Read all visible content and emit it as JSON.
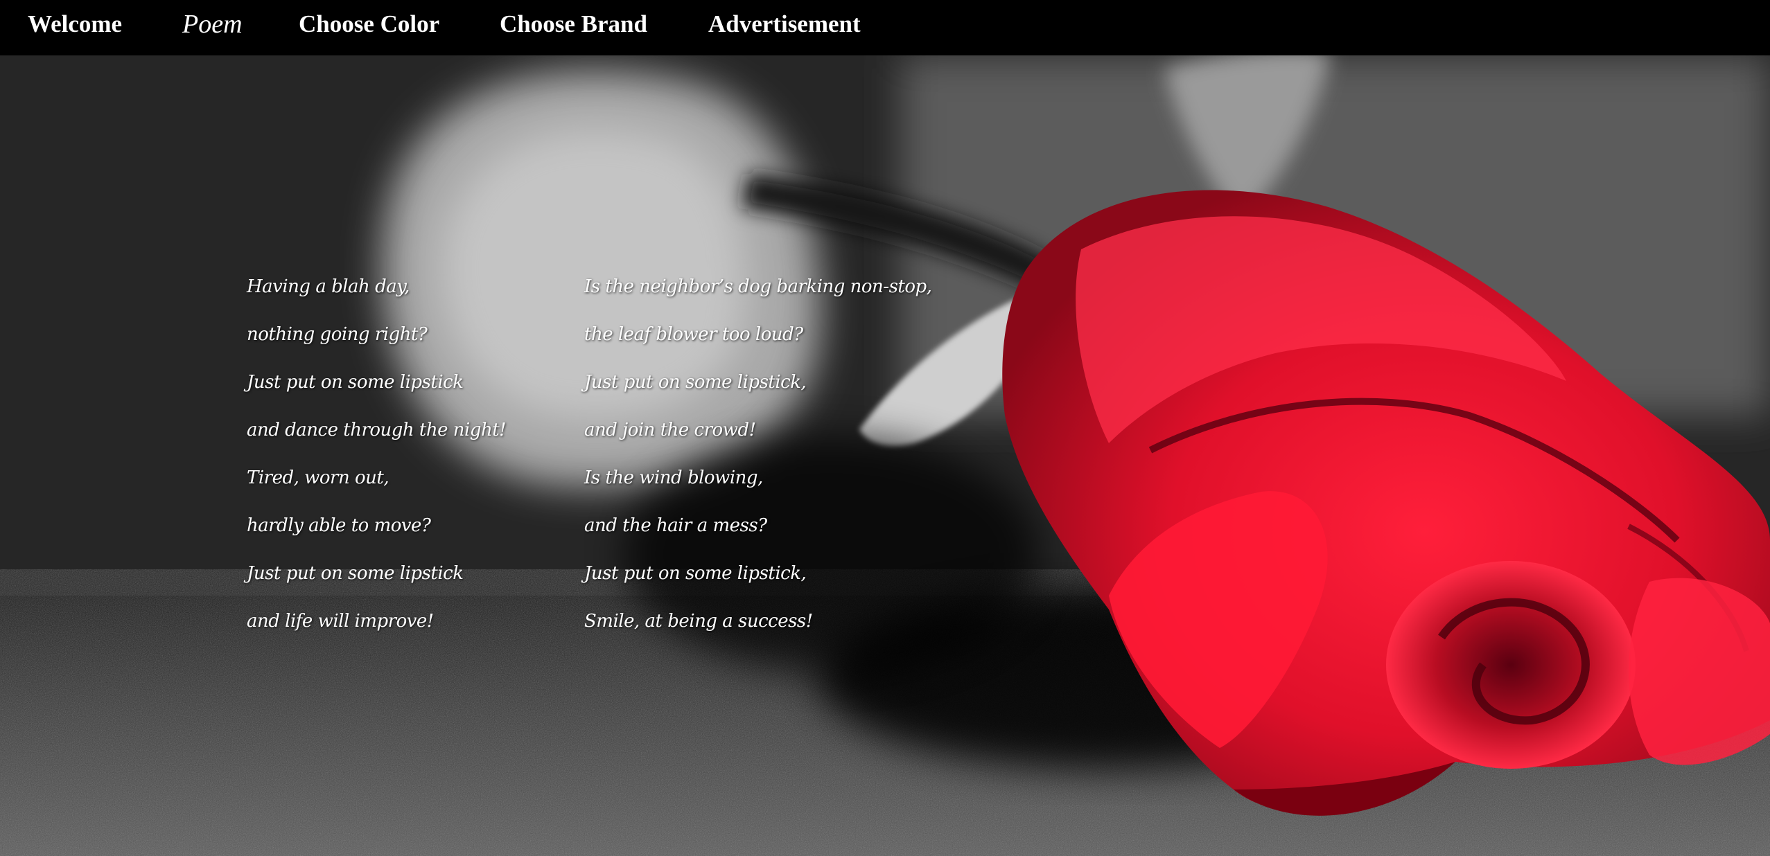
{
  "nav": {
    "items": [
      {
        "label": "Welcome",
        "active": false
      },
      {
        "label": "Poem",
        "active": true
      },
      {
        "label": "Choose Color",
        "active": false
      },
      {
        "label": "Choose Brand",
        "active": false
      },
      {
        "label": "Advertisement",
        "active": false
      }
    ]
  },
  "poem": {
    "column1": [
      "Having a blah day,",
      "nothing going right?",
      "Just put on some lipstick",
      "and dance through the night!",
      "Tired, worn out,",
      "hardly able to move?",
      "Just put on some lipstick",
      "and life will improve!"
    ],
    "column2": [
      "Is the neighbor’s dog barking non-stop,",
      "the leaf blower too loud?",
      "Just put on some lipstick,",
      "and join the crowd!",
      "Is the wind blowing,",
      "and the hair a mess?",
      "Just put on some lipstick,",
      "Smile, at being a success!"
    ]
  },
  "colors": {
    "rose": "#e8102a",
    "rose_dark": "#7a0010",
    "nav_bg": "#000000",
    "text": "#ffffff"
  }
}
